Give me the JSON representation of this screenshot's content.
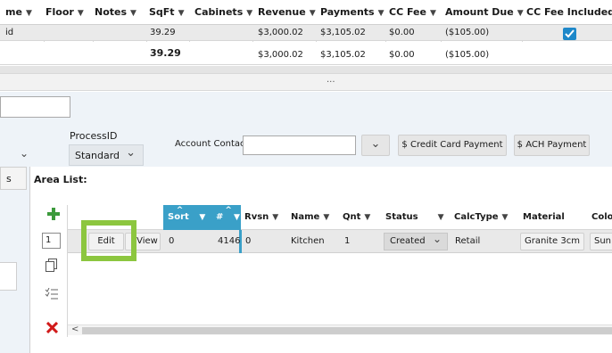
{
  "top_grid": {
    "headers": [
      "me",
      "Floor",
      "Notes",
      "SqFt",
      "Cabinets",
      "Revenue",
      "Payments",
      "CC Fee",
      "Amount Due",
      "CC Fee Included"
    ],
    "row1": {
      "name": "id",
      "sqft": "39.29",
      "revenue": "$3,000.02",
      "payments": "$3,105.02",
      "cc_fee": "$0.00",
      "amount_due": "($105.00)",
      "cc_fee_included": true
    },
    "totals": {
      "sqft": "39.29",
      "revenue": "$3,000.02",
      "payments": "$3,105.02",
      "cc_fee": "$0.00",
      "amount_due": "($105.00)"
    },
    "splitter": "..."
  },
  "form": {
    "process_id_label": "ProcessID",
    "process_id_value": "Standard",
    "account_contact_label": "Account Contact:",
    "account_contact_value": "",
    "credit_card_button": "$ Credit Card Payment",
    "ach_button": "$ ACH Payment"
  },
  "tabs": {
    "left_tab": "s"
  },
  "area_list": {
    "title": "Area List:",
    "qty_value": "1",
    "columns": [
      "Sort",
      "#",
      "Rvsn",
      "Name",
      "Qnt",
      "Status",
      "CalcType",
      "Material",
      "Colo"
    ],
    "row": {
      "edit": "Edit",
      "view": "View",
      "sort": "0",
      "number": "4146",
      "rvsn": "0",
      "name": "Kitchen",
      "qnt": "1",
      "status": "Created",
      "calc_type": "Retail",
      "material": "Granite 3cm",
      "color": "Sun"
    },
    "scroll_left": "<"
  },
  "colors": {
    "accent_blue": "#3aa0c8",
    "highlight_green": "#8cc63f",
    "delete_red": "#d11a1a",
    "add_green": "#3c9a3c",
    "checkbox_blue": "#1e88c9",
    "panel_bg": "#eef3f8"
  }
}
